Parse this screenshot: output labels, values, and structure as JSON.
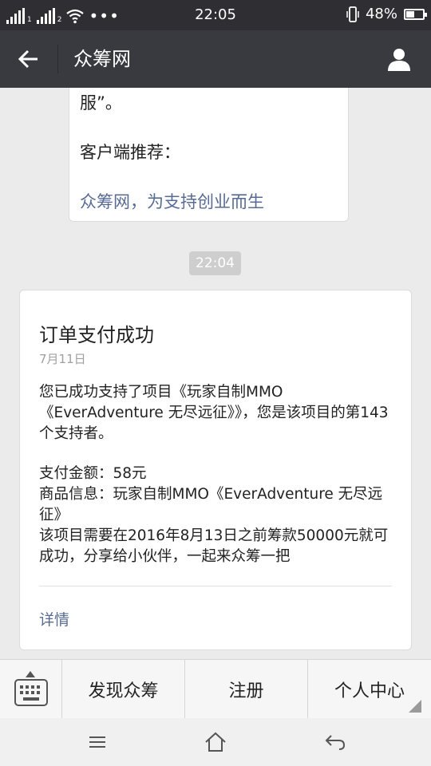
{
  "status_bar": {
    "signal1_label": "1",
    "signal2_label": "2",
    "time": "22:05",
    "battery": "48%"
  },
  "header": {
    "title": "众筹网"
  },
  "previous_message": {
    "line1": "服”。",
    "line2": "客户端推荐：",
    "link": "众筹网，为支持创业而生"
  },
  "time_badge": "22:04",
  "order_card": {
    "title": "订单支付成功",
    "date": "7月11日",
    "para1": "您已成功支持了项目《玩家自制MMO《EverAdventure 无尽远征》》，您是该项目的第143个支持者。",
    "para2_lines": [
      "支付金额：58元",
      "商品信息：玩家自制MMO《EverAdventure 无尽远征》",
      "该项目需要在2016年8月13日之前筹款50000元就可成功，分享给小伙伴，一起来众筹一把"
    ],
    "details": "详情"
  },
  "menu": {
    "items": [
      "发现众筹",
      "注册",
      "个人中心"
    ]
  },
  "colors": {
    "status_bar": "#2e2e33",
    "title_bar": "#393a3f",
    "background": "#ebebeb",
    "link": "#576b95"
  }
}
